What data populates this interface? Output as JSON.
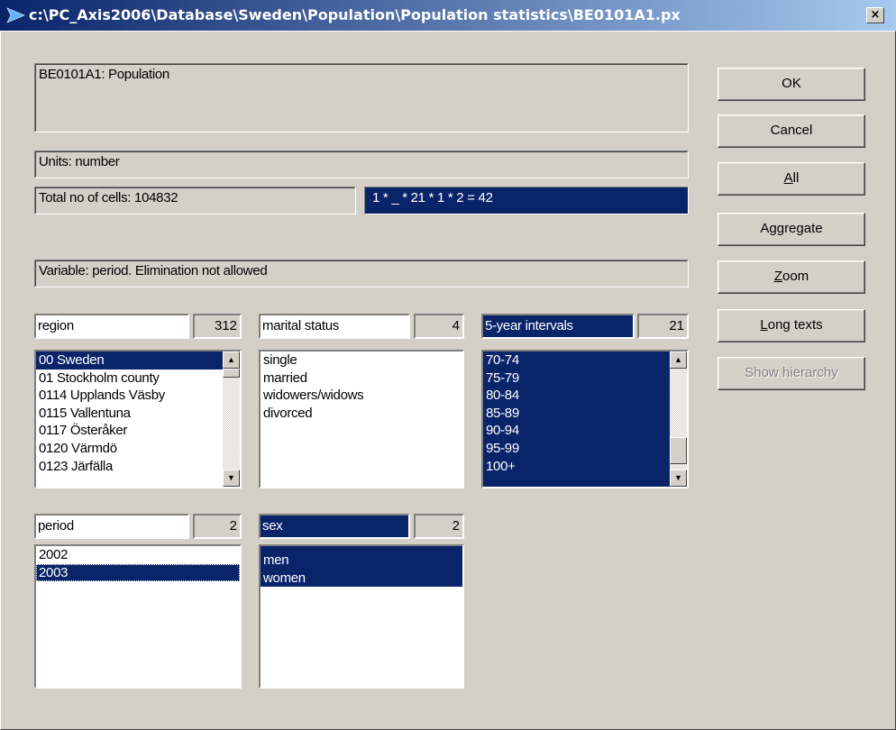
{
  "window": {
    "title": "c:\\PC_Axis2006\\Database\\Sweden\\Population\\Population statistics\\BE0101A1.px",
    "close_glyph": "×"
  },
  "info": {
    "table_title": "BE0101A1: Population",
    "units": "Units: number",
    "total_cells": "Total no of cells:  104832",
    "selection_formula": "1 * _ * 21 * 1 * 2  =  42",
    "variable_status": "Variable: period. Elimination not allowed"
  },
  "buttons": {
    "ok": "OK",
    "cancel": "Cancel",
    "all_prefix": "",
    "all_key": "A",
    "all_rest": "ll",
    "aggregate": "Aggregate",
    "zoom_key": "Z",
    "zoom_rest": "oom",
    "long_key": "L",
    "long_rest": "ong texts",
    "show_hierarchy": "Show hierarchy"
  },
  "variables": {
    "region": {
      "name": "region",
      "count": "312",
      "items": [
        "00 Sweden",
        "01 Stockholm county",
        "0114 Upplands Väsby",
        "0115 Vallentuna",
        "0117 Österåker",
        "0120 Värmdö",
        "0123 Järfälla"
      ]
    },
    "marital": {
      "name": "marital status",
      "count": "4",
      "items": [
        "single",
        "married",
        "widowers/widows",
        "divorced"
      ]
    },
    "age": {
      "name": "5-year intervals",
      "count": "21",
      "items": [
        "70-74",
        "75-79",
        "80-84",
        "85-89",
        "90-94",
        "95-99",
        "100+"
      ]
    },
    "period": {
      "name": "period",
      "count": "2",
      "items": [
        "2002",
        "2003"
      ]
    },
    "sex": {
      "name": "sex",
      "count": "2",
      "items": [
        "men",
        "women"
      ]
    }
  },
  "colors": {
    "selection": "#0a246a",
    "face": "#d4d0c8"
  }
}
